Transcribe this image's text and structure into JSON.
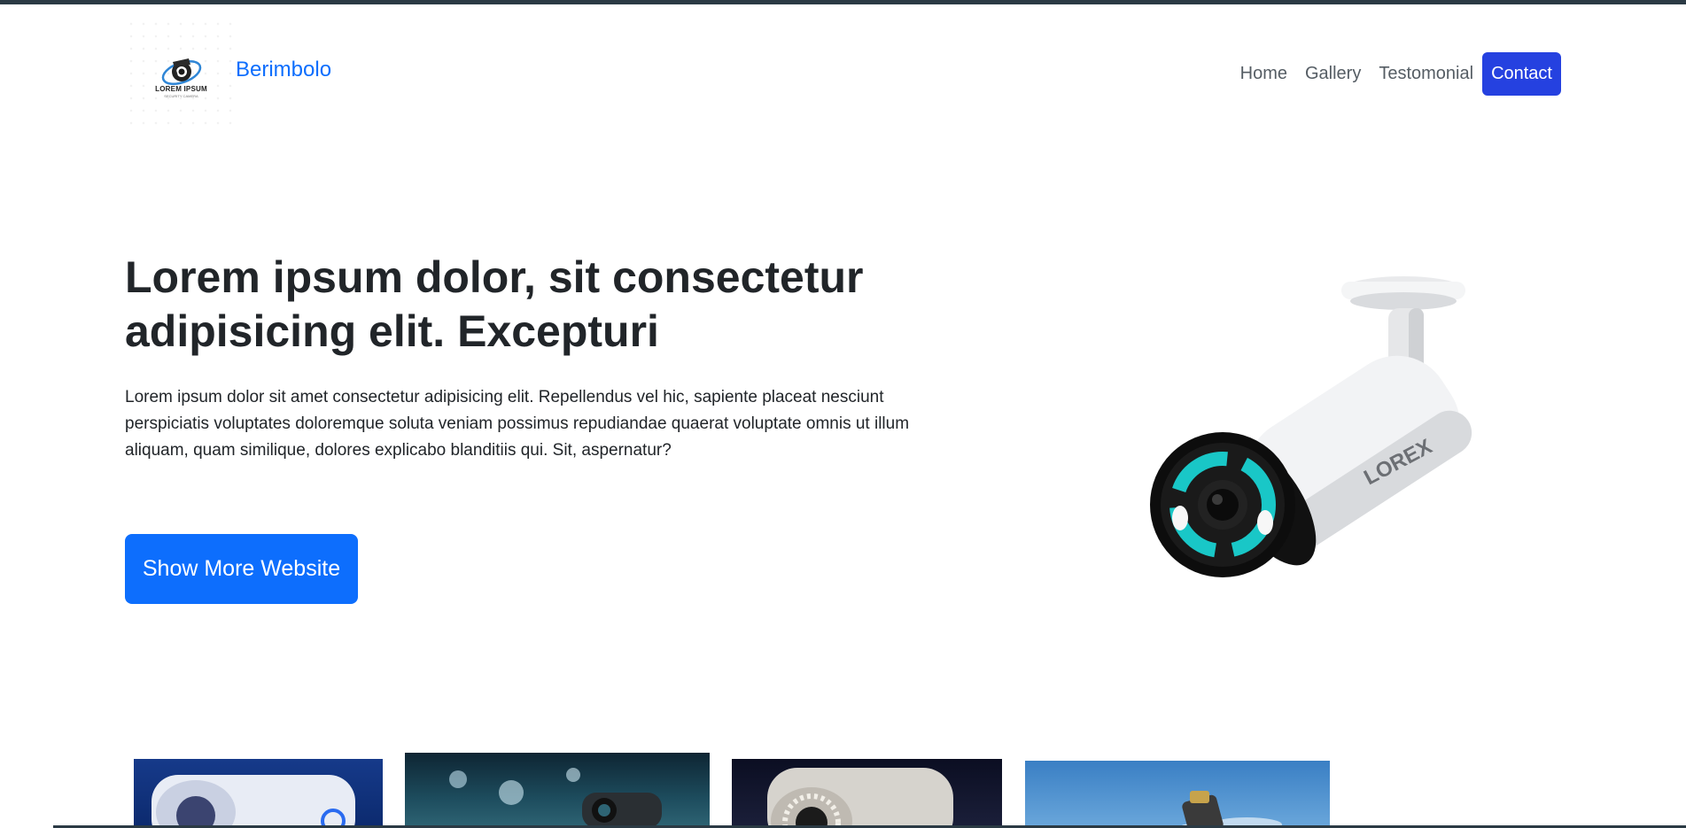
{
  "brand": {
    "logo_text": "LOREM IPSUM",
    "logo_subtext": "SECURITY CAMERA",
    "name": "Berimbolo"
  },
  "nav": {
    "items": [
      {
        "label": "Home"
      },
      {
        "label": "Gallery"
      },
      {
        "label": "Testomonial"
      }
    ],
    "contact_label": "Contact"
  },
  "hero": {
    "title": "Lorem ipsum dolor, sit consectetur adipisicing elit. Excepturi",
    "text": "Lorem ipsum dolor sit amet consectetur adipisicing elit. Repellendus vel hic, sapiente placeat nesciunt perspiciatis voluptates doloremque soluta veniam possimus repudiandae quaerat voluptate omnis ut illum aliquam, quam similique, dolores explicabo blanditiis qui. Sit, aspernatur?",
    "button_label": "Show More Website",
    "camera_brand": "LOREX"
  },
  "colors": {
    "primary": "#0d6efd",
    "contact": "#2541e0",
    "top_bar": "#2b3a44",
    "camera_ring": "#19c7c7"
  },
  "icons": {
    "logo": "camera-eye-logo-icon"
  }
}
